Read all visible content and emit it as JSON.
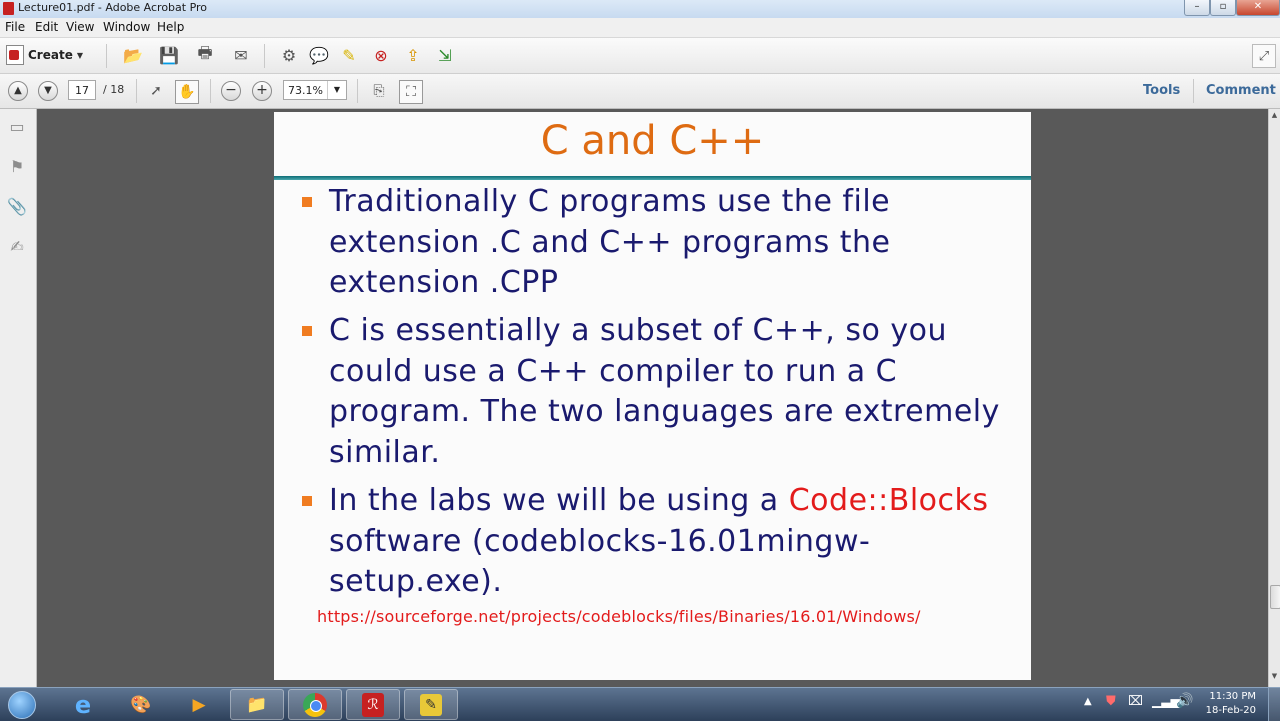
{
  "window": {
    "title": "Lecture01.pdf - Adobe Acrobat Pro",
    "controls": [
      "–",
      "▫",
      "✕"
    ]
  },
  "menu": {
    "items": [
      "File",
      "Edit",
      "View",
      "Window",
      "Help"
    ]
  },
  "toolbar": {
    "create_label": "Create"
  },
  "nav": {
    "current_page": "17",
    "total_pages": "/ 18",
    "zoom": "73.1%",
    "tools_label": "Tools",
    "comment_label": "Comment"
  },
  "slide": {
    "title": "C and C++",
    "bullet1": "Traditionally C programs use the file extension .C and C++ programs the extension .CPP",
    "bullet2": "C is essentially a subset of C++, so you could use a C++ compiler to run a C program. The two languages are extremely similar.",
    "bullet3_before": "In the labs we will be using a ",
    "bullet3_highlight": "Code::Blocks",
    "bullet3_after": " software (codeblocks-16.01mingw-setup.exe).",
    "link": "https://sourceforge.net/projects/codeblocks/files/Binaries/16.01/Windows/"
  },
  "taskbar": {
    "time": "11:30 PM",
    "date": "18-Feb-20"
  },
  "colors": {
    "slide_title": "#de6b12",
    "slide_text": "#1a1a6e",
    "highlight_red": "#e31b1b",
    "bullet": "#f07c21",
    "rule": "#0e6d76"
  }
}
